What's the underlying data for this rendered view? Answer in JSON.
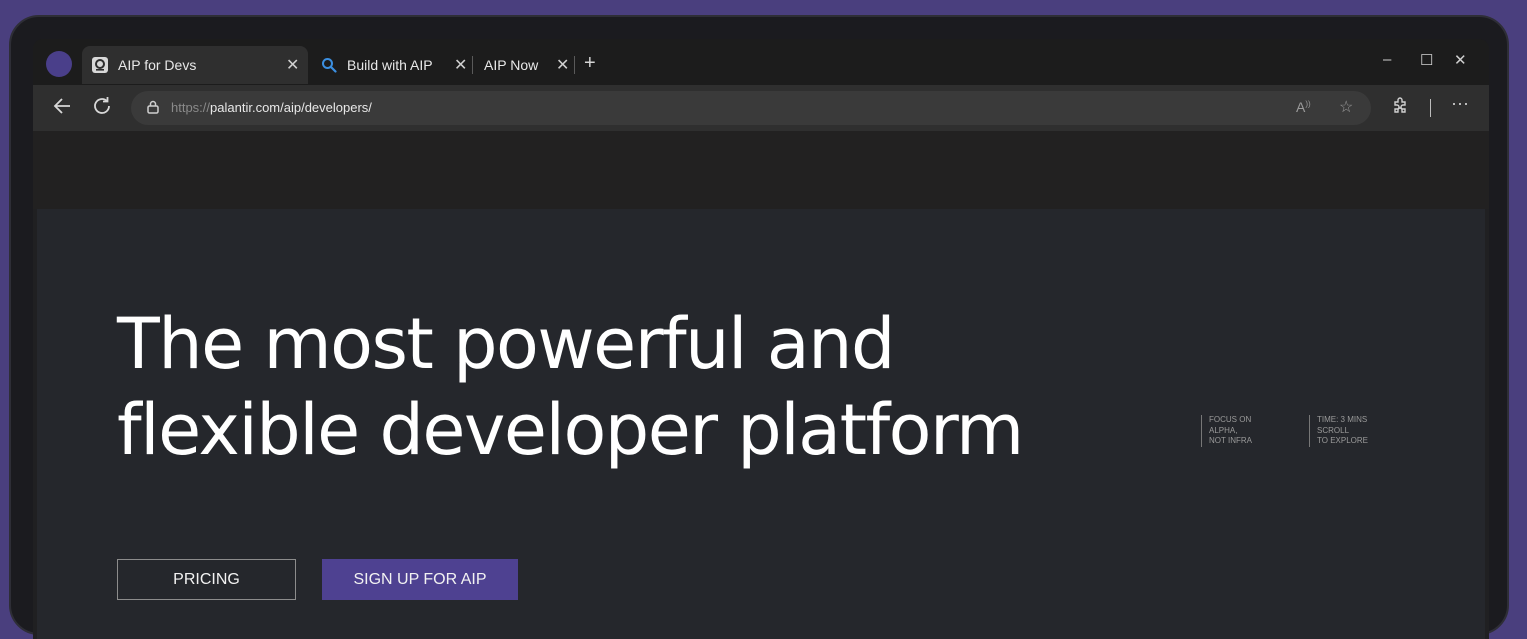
{
  "browser": {
    "tabs": [
      {
        "label": "AIP for Devs",
        "active": true,
        "icon": "palantir-favicon"
      },
      {
        "label": "Build with AIP",
        "active": false,
        "icon": "search-icon"
      },
      {
        "label": "AIP Now",
        "active": false,
        "icon": ""
      }
    ],
    "new_tab": "+",
    "address": {
      "protocol": "https://",
      "path": "palantir.com/aip/developers/"
    },
    "window_controls": {
      "minimize": "–",
      "maximize": "☐",
      "close": "✕"
    }
  },
  "hero": {
    "headline_line1": "The most powerful and",
    "headline_line2": "flexible developer platform",
    "meta": [
      {
        "line1": "FOCUS ON",
        "line2": "ALPHA,",
        "line3": "NOT INFRA"
      },
      {
        "line1": "TIME: 3 MINS",
        "line2": "SCROLL",
        "line3": "TO EXPLORE"
      }
    ],
    "buttons": {
      "pricing": "PRICING",
      "signup": "SIGN UP FOR AIP"
    }
  },
  "colors": {
    "background": "#4a3f7e",
    "accent": "#4e4191",
    "hero_bg": "#25272c"
  }
}
